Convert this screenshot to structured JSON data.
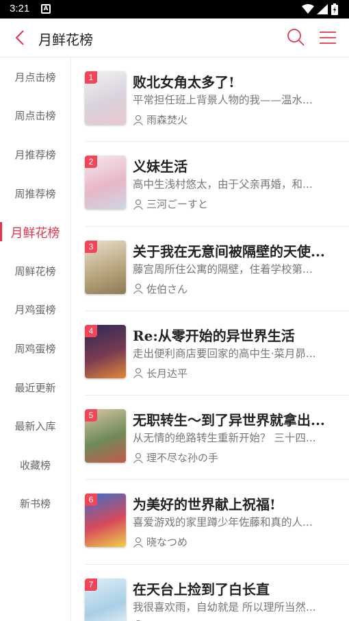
{
  "status_bar": {
    "time": "3:21",
    "notification_icon": "A"
  },
  "header": {
    "title": "月鲜花榜",
    "accent": "#e8334a"
  },
  "sidebar": {
    "items": [
      {
        "label": "月点击榜",
        "active": false
      },
      {
        "label": "周点击榜",
        "active": false
      },
      {
        "label": "月推荐榜",
        "active": false
      },
      {
        "label": "周推荐榜",
        "active": false
      },
      {
        "label": "月鲜花榜",
        "active": true
      },
      {
        "label": "周鲜花榜",
        "active": false
      },
      {
        "label": "月鸡蛋榜",
        "active": false
      },
      {
        "label": "周鸡蛋榜",
        "active": false
      },
      {
        "label": "最近更新",
        "active": false
      },
      {
        "label": "最新入库",
        "active": false
      },
      {
        "label": "收藏榜",
        "active": false
      },
      {
        "label": "新书榜",
        "active": false
      }
    ]
  },
  "books": [
    {
      "rank": "1",
      "title": "败北女角太多了!",
      "desc": "平常担任班上背景人物的我——温水...",
      "author": "雨森焚火",
      "cover_colors": [
        "#f3f0f2",
        "#d9d2dc",
        "#e9c7cf"
      ]
    },
    {
      "rank": "2",
      "title": "义妹生活",
      "desc": "高中生浅村悠太，由于父亲再婚，和...",
      "author": "三河ごーすと",
      "cover_colors": [
        "#f6e9ee",
        "#e7b7c6",
        "#cfd5e6"
      ]
    },
    {
      "rank": "3",
      "title": "关于我在无意间被隔壁的天使...",
      "desc": "藤宫周所住公寓的隔壁，住着学校第...",
      "author": "佐伯さん",
      "cover_colors": [
        "#e9e0cf",
        "#b9a77f",
        "#8c7a55"
      ]
    },
    {
      "rank": "4",
      "title": "Re:从零开始的异世界生活",
      "desc": "走出便利商店要回家的高中生·菜月昴...",
      "author": "长月达平",
      "cover_colors": [
        "#2b2a55",
        "#7a3b52",
        "#e08a3a"
      ]
    },
    {
      "rank": "5",
      "title": "无职转生～到了异世界就拿出...",
      "desc": "从无情的绝路转生重新开始？ 三十四...",
      "author": "理不尽な孙の手",
      "cover_colors": [
        "#d8c6a2",
        "#6f8a5a",
        "#c45a48"
      ]
    },
    {
      "rank": "6",
      "title": "为美好的世界献上祝福!",
      "desc": "喜爱游戏的家里蹲少年佐藤和真的人...",
      "author": "晓なつめ",
      "cover_colors": [
        "#3b6fc9",
        "#d64a5c",
        "#f0d04a"
      ]
    },
    {
      "rank": "7",
      "title": "在天台上捡到了白长直",
      "desc": "我很喜欢雨，自幼就是 所以理所当然...",
      "author": "",
      "cover_colors": [
        "#dfeef6",
        "#a9cfe6",
        "#f3f6fb"
      ]
    }
  ]
}
